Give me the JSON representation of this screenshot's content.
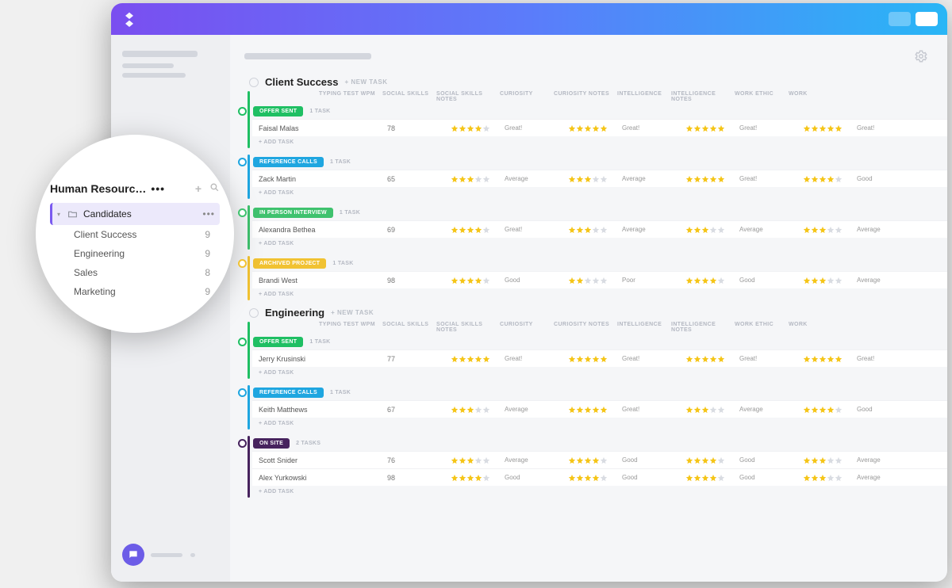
{
  "workspace": {
    "title": "Human Resourc…",
    "folder": "Candidates",
    "lists": [
      {
        "label": "Client Success",
        "count": 9
      },
      {
        "label": "Engineering",
        "count": 9
      },
      {
        "label": "Sales",
        "count": 8
      },
      {
        "label": "Marketing",
        "count": 9
      }
    ]
  },
  "ui": {
    "new_task": "+ NEW TASK",
    "add_task": "+ ADD TASK",
    "columns": {
      "typing": "TYPING TEST WPM",
      "social": "SOCIAL SKILLS",
      "social_notes": "SOCIAL SKILLS NOTES",
      "curiosity": "CURIOSITY",
      "curiosity_notes": "CURIOSITY NOTES",
      "intelligence": "INTELLIGENCE",
      "intelligence_notes": "INTELLIGENCE NOTES",
      "work_ethic": "WORK ETHIC",
      "work_ethic_notes": "WORK"
    },
    "task_labels": {
      "1": "1 TASK",
      "2": "2 TASKS"
    },
    "notes": {
      "great": "Great!",
      "avg": "Average",
      "good": "Good",
      "poor": "Poor"
    }
  },
  "status_colors": {
    "offer_sent": "#1fbf63",
    "reference_calls": "#1fa6e0",
    "in_person": "#3fc26e",
    "archived": "#f1c232",
    "on_site": "#47235e"
  },
  "groups": [
    {
      "title": "Client Success",
      "blocks": [
        {
          "status": "OFFER SENT",
          "color_key": "offer_sent",
          "count_key": "1",
          "rows": [
            {
              "name": "Faisal Malas",
              "typing": 78,
              "social": 4,
              "social_n": "great",
              "cur": 5,
              "cur_n": "great",
              "int": 5,
              "int_n": "great",
              "we": 5,
              "we_n": "great"
            }
          ]
        },
        {
          "status": "REFERENCE CALLS",
          "color_key": "reference_calls",
          "count_key": "1",
          "rows": [
            {
              "name": "Zack Martin",
              "typing": 65,
              "social": 3,
              "social_n": "avg",
              "cur": 3,
              "cur_n": "avg",
              "int": 5,
              "int_n": "great",
              "we": 4,
              "we_n": "good"
            }
          ]
        },
        {
          "status": "IN PERSON INTERVIEW",
          "color_key": "in_person",
          "count_key": "1",
          "rows": [
            {
              "name": "Alexandra Bethea",
              "typing": 69,
              "social": 4,
              "social_n": "great",
              "cur": 3,
              "cur_n": "avg",
              "int": 3,
              "int_n": "avg",
              "we": 3,
              "we_n": "avg"
            }
          ]
        },
        {
          "status": "ARCHIVED PROJECT",
          "color_key": "archived",
          "count_key": "1",
          "rows": [
            {
              "name": "Brandi West",
              "typing": 98,
              "social": 4,
              "social_n": "good",
              "cur": 2,
              "cur_n": "poor",
              "int": 4,
              "int_n": "good",
              "we": 3,
              "we_n": "avg"
            }
          ]
        }
      ]
    },
    {
      "title": "Engineering",
      "blocks": [
        {
          "status": "OFFER SENT",
          "color_key": "offer_sent",
          "count_key": "1",
          "rows": [
            {
              "name": "Jerry Krusinski",
              "typing": 77,
              "social": 5,
              "social_n": "great",
              "cur": 5,
              "cur_n": "great",
              "int": 5,
              "int_n": "great",
              "we": 5,
              "we_n": "great"
            }
          ]
        },
        {
          "status": "REFERENCE CALLS",
          "color_key": "reference_calls",
          "count_key": "1",
          "rows": [
            {
              "name": "Keith Matthews",
              "typing": 67,
              "social": 3,
              "social_n": "avg",
              "cur": 5,
              "cur_n": "great",
              "int": 3,
              "int_n": "avg",
              "we": 4,
              "we_n": "good"
            }
          ]
        },
        {
          "status": "ON SITE",
          "color_key": "on_site",
          "count_key": "2",
          "rows": [
            {
              "name": "Scott Snider",
              "typing": 76,
              "social": 3,
              "social_n": "avg",
              "cur": 4,
              "cur_n": "good",
              "int": 4,
              "int_n": "good",
              "we": 3,
              "we_n": "avg"
            },
            {
              "name": "Alex Yurkowski",
              "typing": 98,
              "social": 4,
              "social_n": "good",
              "cur": 4,
              "cur_n": "good",
              "int": 4,
              "int_n": "good",
              "we": 3,
              "we_n": "avg"
            }
          ]
        }
      ]
    }
  ]
}
